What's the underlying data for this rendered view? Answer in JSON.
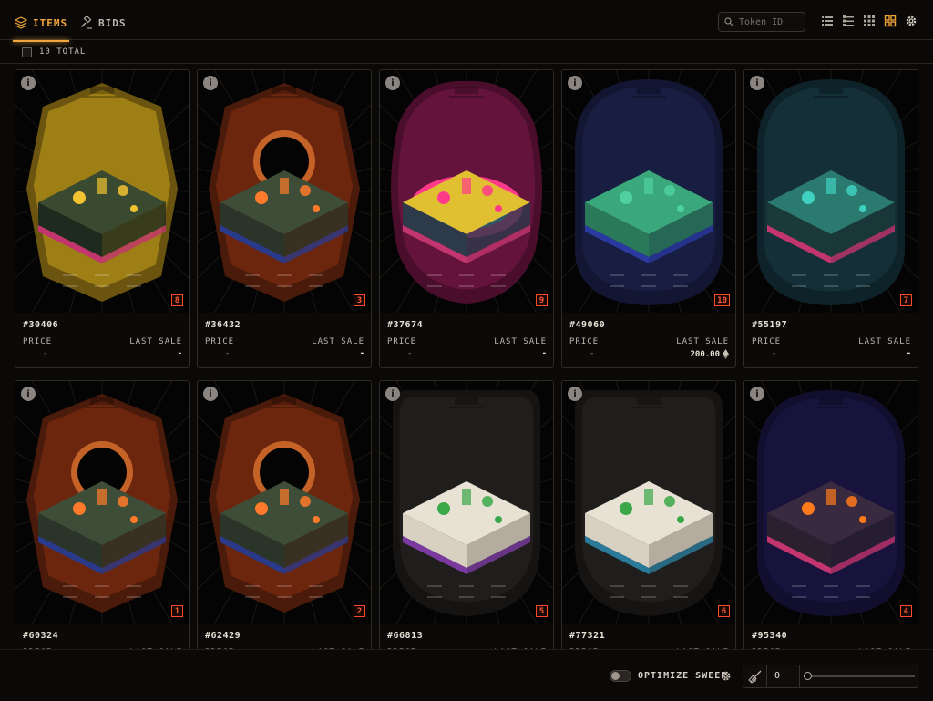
{
  "tabs": {
    "items": "ITEMS",
    "bids": "BIDS"
  },
  "search": {
    "placeholder": "Token ID"
  },
  "summary": {
    "total": "10 TOTAL"
  },
  "labels": {
    "price": "PRICE",
    "last_sale": "LAST SALE"
  },
  "cards": [
    {
      "id": "#30406",
      "rank": "8",
      "price": "-",
      "last_sale": "-",
      "eth_icon": false
    },
    {
      "id": "#36432",
      "rank": "3",
      "price": "-",
      "last_sale": "-",
      "eth_icon": false
    },
    {
      "id": "#37674",
      "rank": "9",
      "price": "-",
      "last_sale": "-",
      "eth_icon": false
    },
    {
      "id": "#49060",
      "rank": "10",
      "price": "-",
      "last_sale": "200.00",
      "eth_icon": true
    },
    {
      "id": "#55197",
      "rank": "7",
      "price": "-",
      "last_sale": "-",
      "eth_icon": false
    },
    {
      "id": "#60324",
      "rank": "1",
      "price": "",
      "last_sale": "",
      "eth_icon": false
    },
    {
      "id": "#62429",
      "rank": "2",
      "price": "",
      "last_sale": "",
      "eth_icon": false
    },
    {
      "id": "#66813",
      "rank": "5",
      "price": "",
      "last_sale": "",
      "eth_icon": false
    },
    {
      "id": "#77321",
      "rank": "6",
      "price": "",
      "last_sale": "",
      "eth_icon": false
    },
    {
      "id": "#95340",
      "rank": "4",
      "price": "",
      "last_sale": "",
      "eth_icon": false
    }
  ],
  "sweep": {
    "label": "OPTIMIZE SWEEP",
    "count": "0",
    "enabled": false
  },
  "colors": {
    "accent": "#f0a63a",
    "rank": "#ff4a2a"
  },
  "icons": [
    "layers-icon",
    "gavel-icon",
    "search-icon",
    "list-view-icon",
    "detail-list-icon",
    "small-grid-icon",
    "large-grid-icon",
    "settings-icon",
    "info-icon",
    "eth-icon",
    "broom-icon"
  ]
}
